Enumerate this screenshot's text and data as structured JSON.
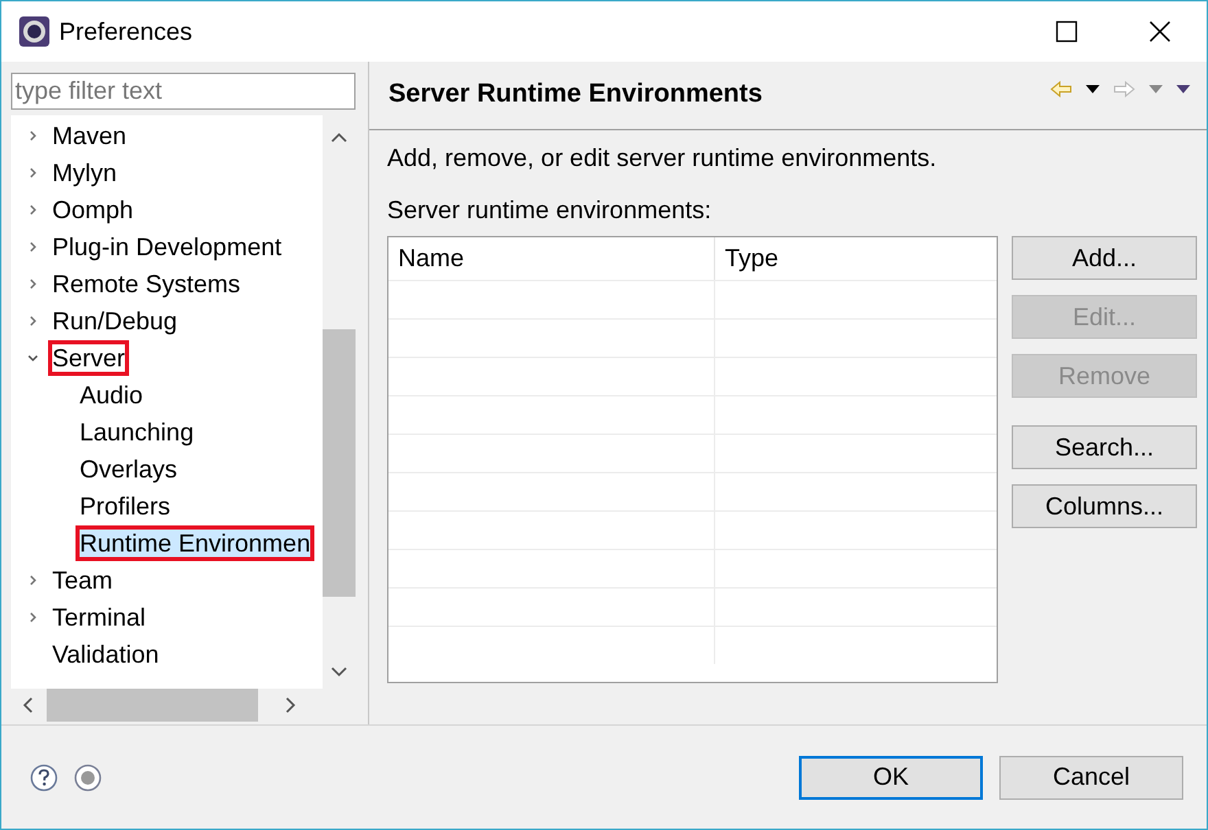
{
  "window": {
    "title": "Preferences"
  },
  "filter": {
    "placeholder": "type filter text"
  },
  "tree": [
    {
      "label": "Maven",
      "expanded": false,
      "selected": false,
      "annotated": false
    },
    {
      "label": "Mylyn",
      "expanded": false,
      "selected": false,
      "annotated": false
    },
    {
      "label": "Oomph",
      "expanded": false,
      "selected": false,
      "annotated": false
    },
    {
      "label": "Plug-in Development",
      "expanded": false,
      "selected": false,
      "annotated": false
    },
    {
      "label": "Remote Systems",
      "expanded": false,
      "selected": false,
      "annotated": false
    },
    {
      "label": "Run/Debug",
      "expanded": false,
      "selected": false,
      "annotated": false
    },
    {
      "label": "Server",
      "expanded": true,
      "selected": false,
      "annotated": true,
      "children": [
        {
          "label": "Audio",
          "selected": false,
          "annotated": false
        },
        {
          "label": "Launching",
          "selected": false,
          "annotated": false
        },
        {
          "label": "Overlays",
          "selected": false,
          "annotated": false
        },
        {
          "label": "Profilers",
          "selected": false,
          "annotated": false
        },
        {
          "label": "Runtime Environmen",
          "selected": true,
          "annotated": true
        }
      ]
    },
    {
      "label": "Team",
      "expanded": false,
      "selected": false,
      "annotated": false
    },
    {
      "label": "Terminal",
      "expanded": false,
      "selected": false,
      "annotated": false
    },
    {
      "label": "Validation",
      "selected": false,
      "annotated": false
    }
  ],
  "page": {
    "title": "Server Runtime Environments",
    "description": "Add, remove, or edit server runtime environments.",
    "list_label": "Server runtime environments:"
  },
  "table": {
    "columns": [
      "Name",
      "Type"
    ]
  },
  "side_buttons": [
    {
      "label": "Add...",
      "disabled": false
    },
    {
      "label": "Edit...",
      "disabled": true
    },
    {
      "label": "Remove",
      "disabled": true
    },
    {
      "label": "Search...",
      "disabled": false
    },
    {
      "label": "Columns...",
      "disabled": false
    }
  ],
  "dialog_buttons": [
    {
      "label": "OK",
      "default": true
    },
    {
      "label": "Cancel",
      "default": false
    }
  ]
}
